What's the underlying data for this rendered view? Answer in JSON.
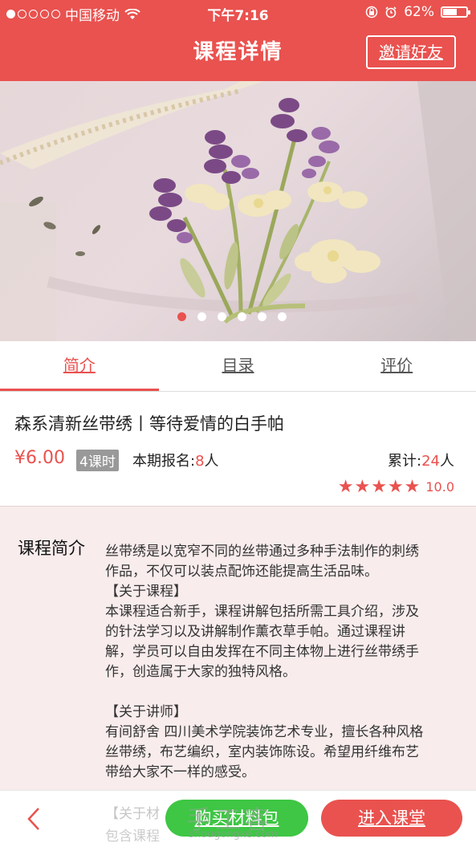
{
  "status_bar": {
    "carrier": "中国移动",
    "time": "下午7:16",
    "battery": "62%",
    "battery_level": 0.62
  },
  "header": {
    "title": "课程详情",
    "invite_button": "邀请好友"
  },
  "banner": {
    "pages": 6,
    "active_page": 1
  },
  "tabs": [
    {
      "label": "简介",
      "active": true
    },
    {
      "label": "目录",
      "active": false
    },
    {
      "label": "评价",
      "active": false
    }
  ],
  "course": {
    "name": "森系清新丝带绣丨等待爱情的白手帕",
    "price": "¥6.00",
    "lessons": "4课时",
    "enrolled_label": "本期报名:",
    "enrolled_count": "8",
    "enrolled_unit": "人",
    "total_label": "累计:",
    "total_count": "24",
    "total_unit": "人",
    "stars": "★★★★★",
    "score": "10.0"
  },
  "intro": {
    "heading": "课程简介",
    "lines": [
      "丝带绣是以宽窄不同的丝带通过多种手法制作的刺绣",
      "作品，不仅可以装点配饰还能提高生活品味。",
      "【关于课程】",
      "本课程适合新手，课程讲解包括所需工具介绍，涉及",
      "的针法学习以及讲解制作薰衣草手帕。通过课程讲",
      "解，学员可以自由发挥在不同主体物上进行丝带绣手",
      "作，创造属于大家的独特风格。",
      "",
      "【关于讲师】",
      "有间舒舍 四川美术学院装饰艺术专业，擅长各种风格",
      "丝带绣，布艺编织，室内装饰陈设。希望用纤维布艺",
      "带给大家不一样的感受。"
    ],
    "peek_1": "【关于材",
    "peek_2": "包含课程"
  },
  "bottom_bar": {
    "buy_button": "购买材料包",
    "enter_button": "进入课堂"
  },
  "watermark": {
    "text": "手工客",
    "url": "shougongke.com"
  },
  "colors": {
    "accent": "#e9524f",
    "buy_green": "#3ec644",
    "intro_bg": "#f8ecec"
  }
}
